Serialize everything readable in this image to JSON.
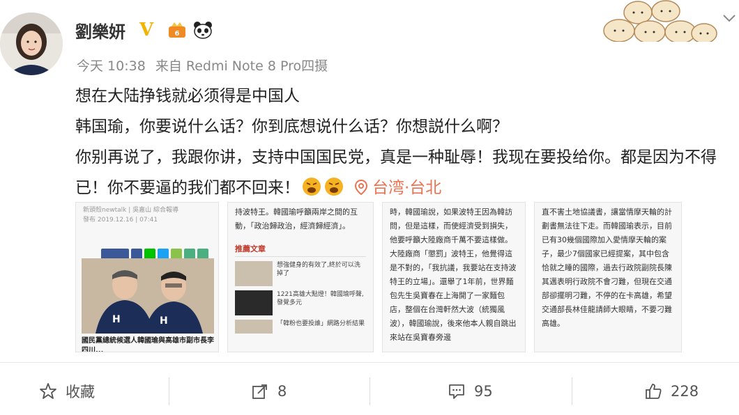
{
  "user": {
    "name": "劉樂妍",
    "verified_badge": "V"
  },
  "meta": {
    "time": "今天 10:38",
    "source": "来自 Redmi Note 8 Pro四摄"
  },
  "post": {
    "lines": [
      "想在大陆挣钱就必须得是中国人",
      "韩国瑜，你要说什么话？你到底想说什么话？你想説什么啊？",
      "你别再说了，我跟你讲，支持中国国民党，真是一种耻辱！我现在要投给你。都是因为不得已！你不要逼的我们都不回来！"
    ],
    "location": "台湾·台北"
  },
  "images": {
    "img1": {
      "source": "新頭殼newtalk | 吳嘉山 綜合報導",
      "date": "發布 2019.12.16 | 07:41",
      "caption": "國民黨總統候選人韓國瑜與高雄市副市長李四川..."
    },
    "img2": {
      "text": "持波特王。韓國瑜呼籲兩岸之間的互動，「政治歸政治，經濟歸經濟」。",
      "rec_title": "推薦文章",
      "rec_items": [
        "想強健身的有效了,終於可以洗掉了",
        "1221高雄大點燈！韓國瑜呼聲,發覺多元",
        "「韓粉也要投誰」網路分析結果"
      ]
    },
    "img3": {
      "text": "時，韓國瑜說，如果波特王因為韓訪問，但是這樣，而使經濟受到損失，他要呼籲大陸廠商千萬不要這樣做。大陸廠商「懲罰」波特王，他覺得這是不對的，「我抗議，我要站在支持波特王的立場」。還舉了1年前，世界麵包先生吳寶春在上海開了一家麵包店，整個在台灣軒然大波（統獨風波），韓國瑜說，後來他本人親自跳出來站在吳寶春旁邊"
    },
    "img4": {
      "text": "直不害土地協議書，讓當情摩天輪的計劃書無法往下走。而韓國瑜表示，目前已有30幾個國際加入愛情摩天輪的案子，最少7個國家已經提案，其中包含恰就之睡的國際，過去行政院副院長陳其邁表明行政院不會刁難，但現在交通部卻擺明刁難，不停的在卡高雄，希望交通部長林佳龍請師大眼睛，不要刁難高雄。"
    }
  },
  "actions": {
    "favorite_label": "收藏",
    "repost_count": "8",
    "comment_count": "95",
    "like_count": "228"
  },
  "colors": {
    "location": "#eb7350",
    "verified": "#f0b400",
    "text": "#222222",
    "meta": "#888888"
  }
}
